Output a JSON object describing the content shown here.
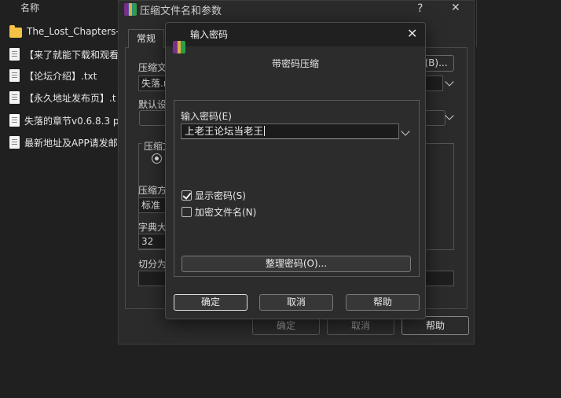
{
  "explorer": {
    "column_header": "名称",
    "files": [
      {
        "name": "The_Lost_Chapters-(",
        "type": "folder",
        "icon": "folder-icon"
      },
      {
        "name": "【来了就能下载和观看",
        "type": "txt",
        "icon": "text-file-icon"
      },
      {
        "name": "【论坛介绍】.txt",
        "type": "txt",
        "icon": "text-file-icon"
      },
      {
        "name": "【永久地址发布页】.t",
        "type": "txt",
        "icon": "text-file-icon"
      },
      {
        "name": "失落的章节v0.6.8.3 p",
        "type": "file",
        "icon": "file-icon"
      },
      {
        "name": "最新地址及APP请发邮",
        "type": "txt",
        "icon": "text-file-icon"
      }
    ]
  },
  "archive_dialog": {
    "title": "压缩文件名和参数",
    "help_glyph": "?",
    "close_glyph": "✕",
    "tab_general": "常规",
    "label_archive_name": "压缩文",
    "archive_name_value": "失落.r",
    "browse_button": "(B)...",
    "label_default": "默认设",
    "label_format": "压缩文",
    "label_method": "压缩方",
    "method_value": "标准",
    "label_dict": "字典大",
    "dict_value": "32",
    "label_split": "切分为",
    "ok": "确定",
    "cancel": "取消",
    "help": "帮助"
  },
  "password_dialog": {
    "title": "输入密码",
    "close_glyph": "✕",
    "heading": "带密码压缩",
    "password_label": "输入密码(E)",
    "password_value": "上老王论坛当老王",
    "show_password_label": "显示密码(S)",
    "show_password_checked": true,
    "encrypt_names_label": "加密文件名(N)",
    "encrypt_names_checked": false,
    "manage_button": "整理密码(O)...",
    "ok": "确定",
    "cancel": "取消",
    "help": "帮助"
  }
}
